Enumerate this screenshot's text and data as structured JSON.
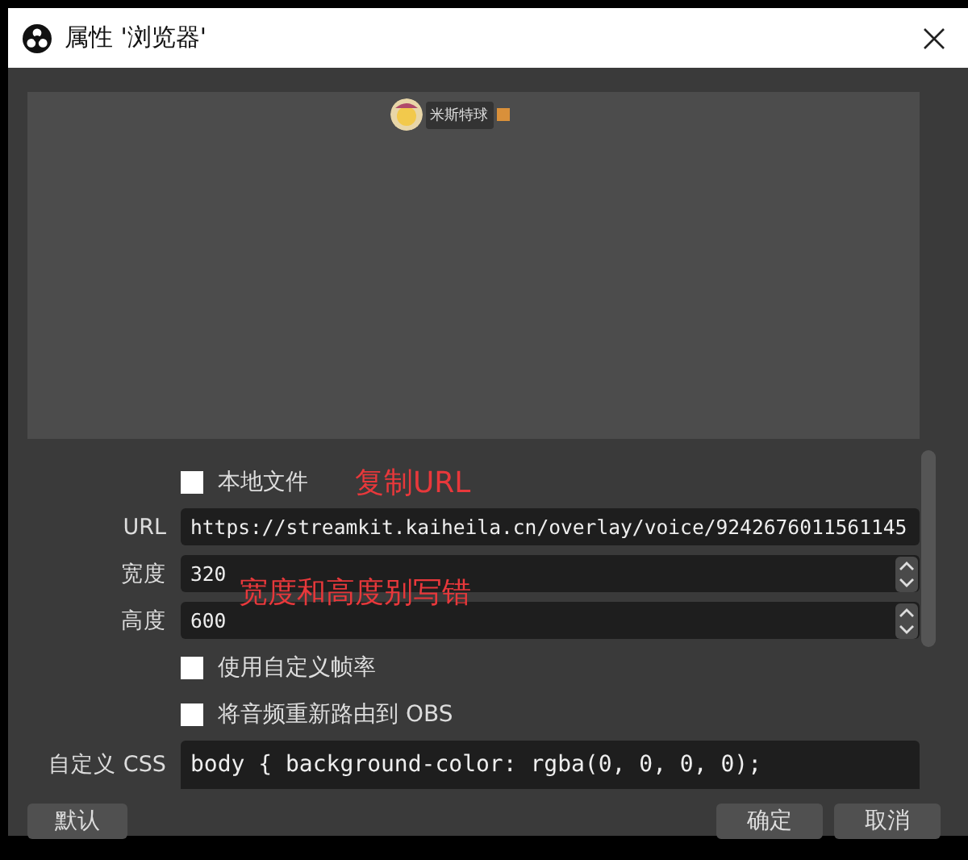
{
  "window": {
    "title": "属性 '浏览器'"
  },
  "preview": {
    "user_name": "米斯特球"
  },
  "form": {
    "local_file": {
      "label": "本地文件",
      "checked": false
    },
    "url": {
      "label": "URL",
      "value": "https://streamkit.kaiheila.cn/overlay/voice/9242676011561145"
    },
    "width": {
      "label": "宽度",
      "value": "320"
    },
    "height": {
      "label": "高度",
      "value": "600"
    },
    "checkboxes": [
      {
        "label": "使用自定义帧率",
        "checked": false
      },
      {
        "label": "将音频重新路由到 OBS",
        "checked": false
      }
    ],
    "css": {
      "label": "自定义 CSS",
      "value": "body { background-color: rgba(0, 0, 0, 0);"
    }
  },
  "annotations": [
    {
      "text": "复制URL"
    },
    {
      "text": "宽度和高度别写错"
    }
  ],
  "buttons": {
    "defaults": "默认",
    "ok": "确定",
    "cancel": "取消"
  }
}
